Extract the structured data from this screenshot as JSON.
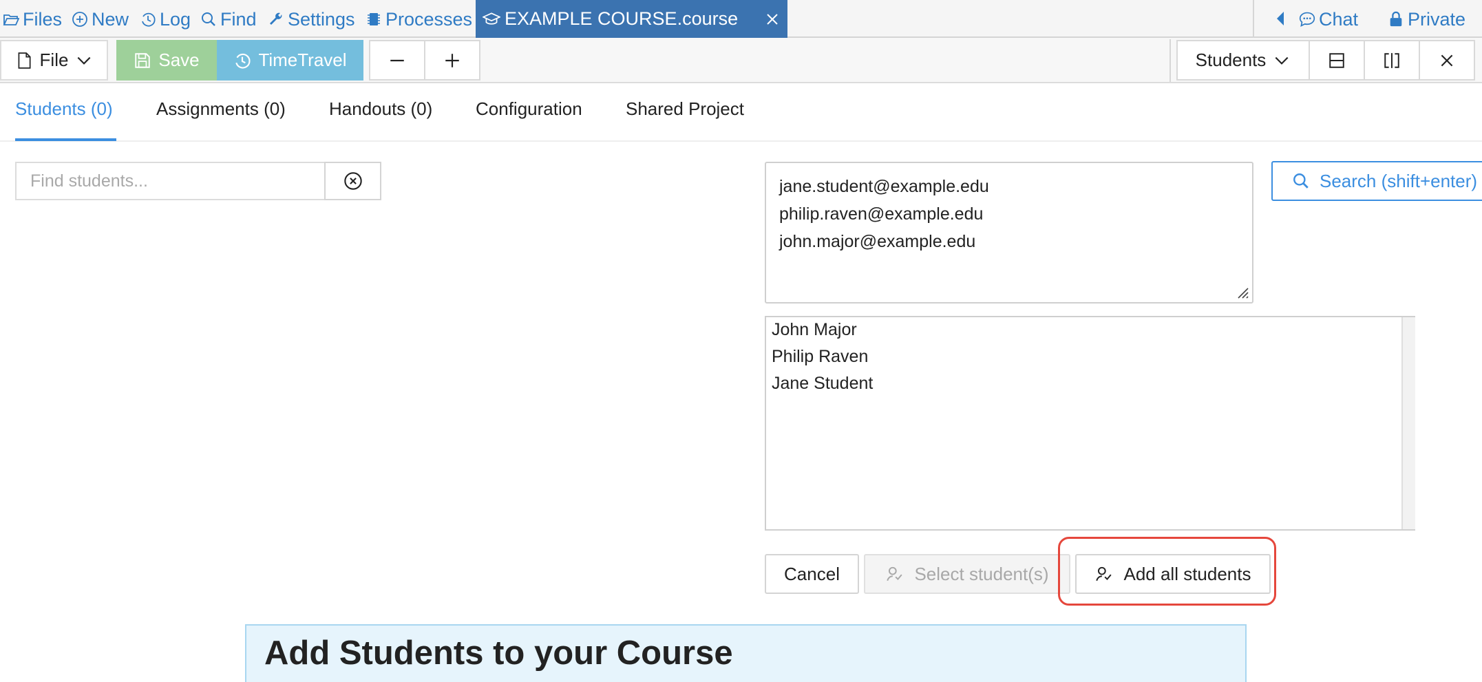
{
  "nav": {
    "items": [
      {
        "label": "Files",
        "icon": "folder-open-icon"
      },
      {
        "label": "New",
        "icon": "plus-circle-icon"
      },
      {
        "label": "Log",
        "icon": "history-icon"
      },
      {
        "label": "Find",
        "icon": "search-icon"
      },
      {
        "label": "Settings",
        "icon": "wrench-icon"
      },
      {
        "label": "Processes",
        "icon": "chip-icon"
      }
    ],
    "active_tab": {
      "label": "EXAMPLE COURSE.course",
      "icon": "graduation-cap-icon",
      "close_icon": "close-icon"
    },
    "right": {
      "chat_label": "Chat",
      "chat_icon": "chat-icon",
      "private_label": "Private",
      "private_icon": "lock-icon",
      "collapse_icon": "caret-left-icon"
    }
  },
  "toolbar": {
    "file_label": "File",
    "save_label": "Save",
    "timetravel_label": "TimeTravel",
    "zoom_out_icon": "minus-icon",
    "zoom_in_icon": "plus-icon",
    "frame_label": "Students",
    "split_horizontal_icon": "split-horizontal-icon",
    "split_vertical_icon": "split-vertical-icon",
    "close_frame_icon": "close-icon"
  },
  "tabs": [
    {
      "label": "Students (0)",
      "active": true
    },
    {
      "label": "Assignments (0)",
      "active": false
    },
    {
      "label": "Handouts (0)",
      "active": false
    },
    {
      "label": "Configuration",
      "active": false
    },
    {
      "label": "Shared Project",
      "active": false
    }
  ],
  "find": {
    "placeholder": "Find students...",
    "value": ""
  },
  "emails": [
    "jane.student@example.edu",
    "philip.raven@example.edu",
    "john.major@example.edu"
  ],
  "search_button": "Search (shift+enter)",
  "results": [
    "John Major",
    "Philip Raven",
    "Jane Student"
  ],
  "actions": {
    "cancel": "Cancel",
    "select": "Select student(s)",
    "add_all": "Add all students"
  },
  "info": {
    "title": "Add Students to your Course"
  },
  "colors": {
    "accent": "#3b8ee0",
    "active_tab_bg": "#3b73b0",
    "save_bg": "#9ed09a",
    "timetravel_bg": "#74bedd",
    "highlight": "#e5473c",
    "info_bg": "#e6f4fc"
  }
}
